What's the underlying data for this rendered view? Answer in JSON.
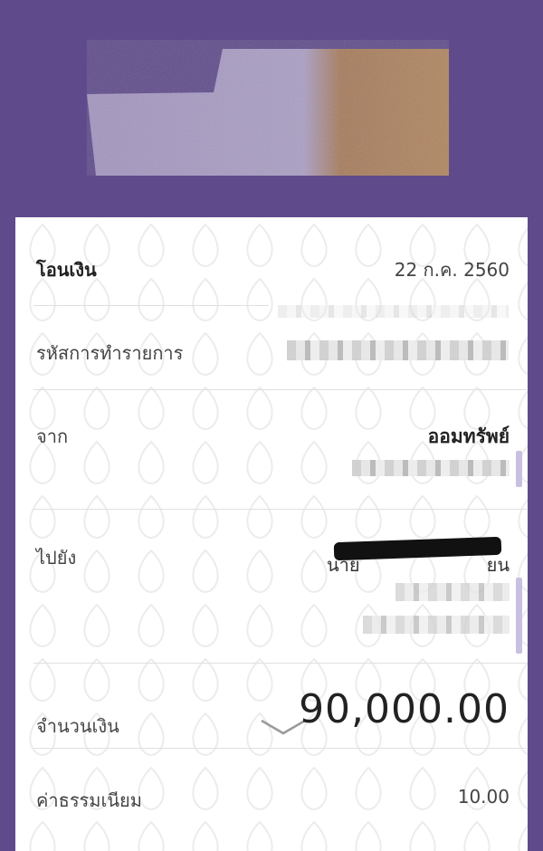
{
  "card": {
    "title": "โอนเงิน",
    "date": "22 ก.ค. 2560",
    "transaction_id_label": "รหัสการทำรายการ",
    "from_label": "จาก",
    "from_account_type": "ออมทรัพย์",
    "to_label": "ไปยัง",
    "to_name_fragment_left": "นาย",
    "to_name_fragment_right": "ยน",
    "amount_label": "จำนวนเงิน",
    "amount_value": "90,000.00",
    "fee_label": "ค่าธรรมเนียม",
    "fee_value": "10.00"
  },
  "colors": {
    "header_bg": "#5f4b8b",
    "card_bg": "#ffffff",
    "divider": "#e0e0e0",
    "accent": "#c9bfe0"
  },
  "icons": {
    "expand": "chevron-down-icon"
  }
}
